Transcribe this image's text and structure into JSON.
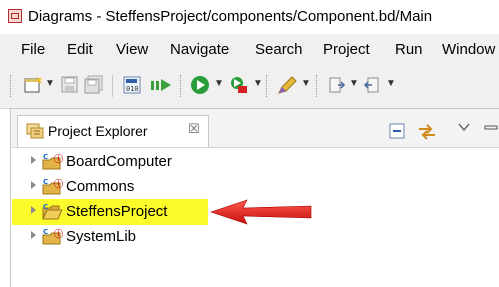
{
  "window": {
    "title": "Diagrams - SteffensProject/components/Component.bd/Main"
  },
  "menu": [
    "File",
    "Edit",
    "View",
    "Navigate",
    "Search",
    "Project",
    "Run",
    "Window"
  ],
  "toolbar": {
    "icons": [
      "new-wizard-icon",
      "save-icon",
      "save-all-icon",
      "binary-build-icon",
      "debug-step-icon",
      "run-icon",
      "external-tools-icon",
      "pen-icon",
      "next-annotation-icon",
      "previous-annotation-icon"
    ]
  },
  "project_explorer": {
    "tab_label": "Project Explorer",
    "close_glyph": "☒",
    "items": [
      {
        "label": "BoardComputer",
        "highlighted": false
      },
      {
        "label": "Commons",
        "highlighted": false
      },
      {
        "label": "SteffensProject",
        "highlighted": true
      },
      {
        "label": "SystemLib",
        "highlighted": false
      }
    ]
  },
  "colors": {
    "highlight": "#fbfb2c",
    "arrow": "#e02020",
    "project_icon": "#c89b2b",
    "error_badge": "#d42020"
  }
}
